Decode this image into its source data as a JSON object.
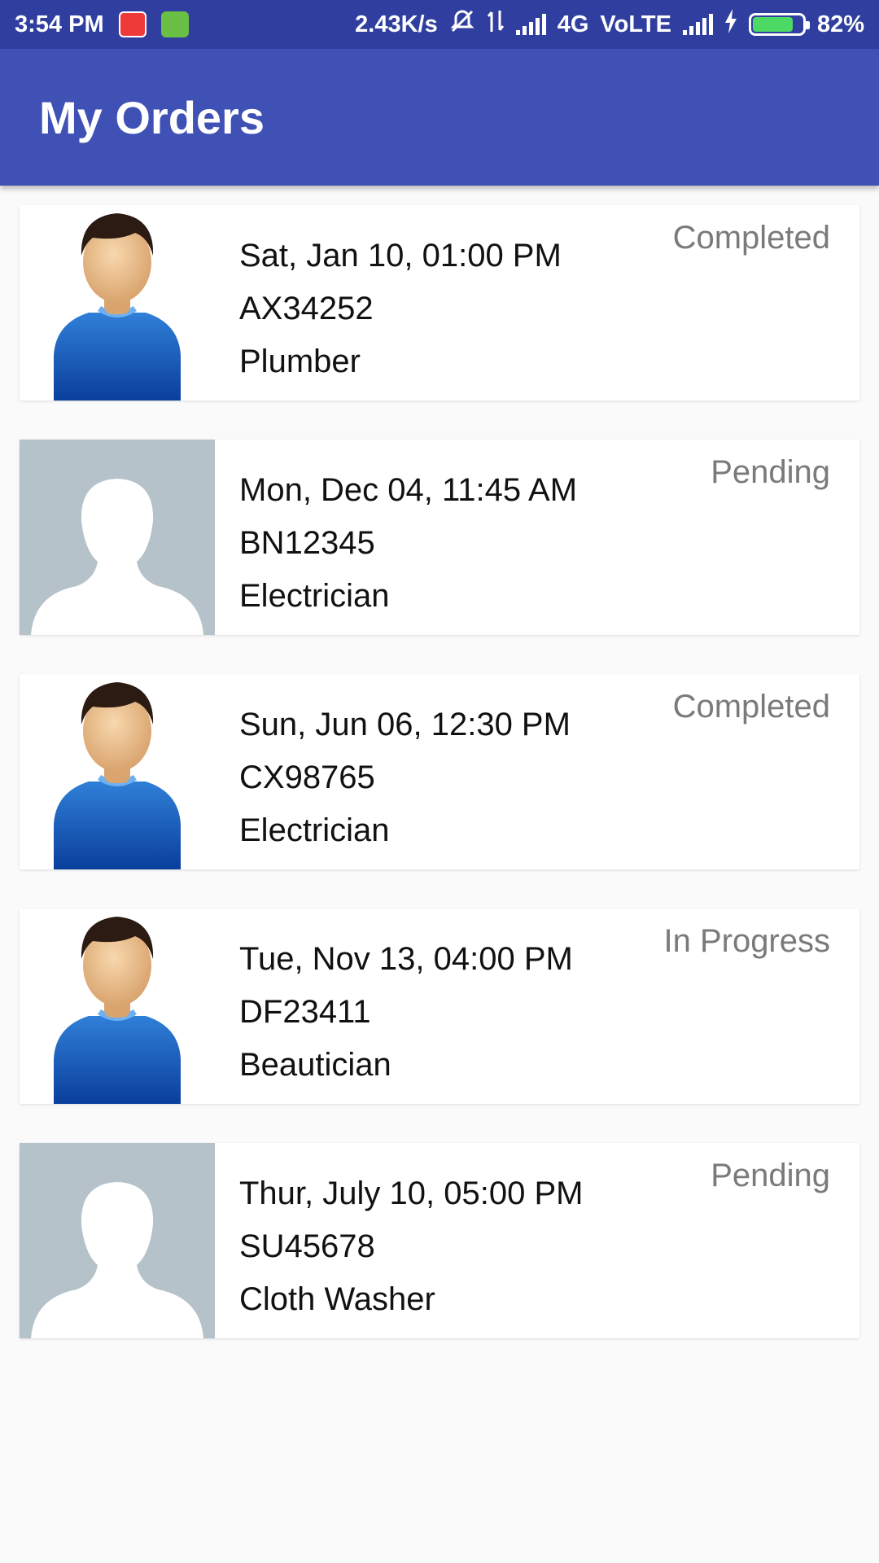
{
  "status_bar": {
    "time": "3:54 PM",
    "network_speed": "2.43K/s",
    "network_type": "4G",
    "volte": "VoLTE",
    "battery": "82%",
    "battery_level": 0.82
  },
  "app_bar": {
    "title": "My Orders"
  },
  "orders": [
    {
      "datetime": "Sat, Jan 10, 01:00 PM",
      "code": "AX34252",
      "service": "Plumber",
      "status": "Completed",
      "avatar": "person-avatar-icon"
    },
    {
      "datetime": "Mon, Dec 04, 11:45 AM",
      "code": "BN12345",
      "service": "Electrician",
      "status": "Pending",
      "avatar": "silhouette-placeholder-icon"
    },
    {
      "datetime": "Sun, Jun 06, 12:30 PM",
      "code": "CX98765",
      "service": "Electrician",
      "status": "Completed",
      "avatar": "person-avatar-icon"
    },
    {
      "datetime": "Tue, Nov 13, 04:00 PM",
      "code": "DF23411",
      "service": "Beautician",
      "status": "In Progress",
      "avatar": "person-avatar-icon"
    },
    {
      "datetime": "Thur, July 10, 05:00 PM",
      "code": "SU45678",
      "service": "Cloth Washer",
      "status": "Pending",
      "avatar": "silhouette-placeholder-icon"
    }
  ],
  "colors": {
    "status_bar": "#303f9f",
    "app_bar": "#3f51b5",
    "background": "#fafafa",
    "status_text": "#7a7a7a",
    "placeholder_bg": "#b6c2c9"
  }
}
